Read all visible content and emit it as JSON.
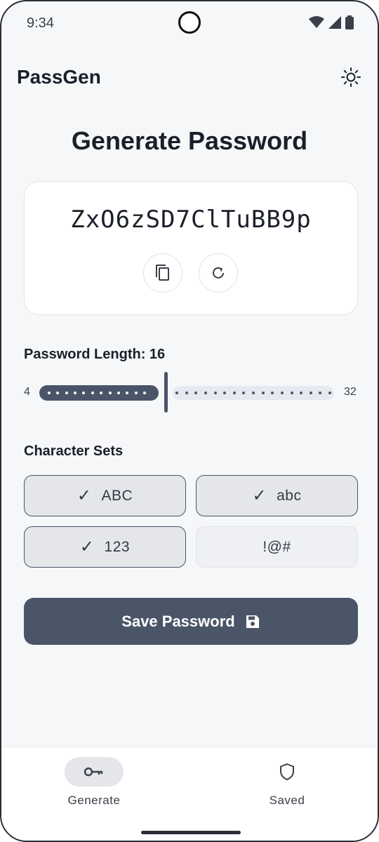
{
  "status_bar": {
    "time": "9:34"
  },
  "app_bar": {
    "title": "PassGen",
    "theme_icon": "sun-icon"
  },
  "page": {
    "title": "Generate Password"
  },
  "password": {
    "value": "ZxO6zSD7ClTuBB9p",
    "copy_icon": "copy-icon",
    "refresh_icon": "refresh-icon"
  },
  "length": {
    "label": "Password Length: 16",
    "value": 16,
    "min_label": "4",
    "max_label": "32",
    "min": 4,
    "max": 32
  },
  "character_sets": {
    "label": "Character Sets",
    "items": [
      {
        "label": "ABC",
        "checked": true
      },
      {
        "label": "abc",
        "checked": true
      },
      {
        "label": "123",
        "checked": true
      },
      {
        "label": "!@#",
        "checked": false
      }
    ],
    "check_mark": "✓"
  },
  "save_button": {
    "label": "Save Password",
    "icon": "save-icon"
  },
  "bottom_nav": {
    "items": [
      {
        "label": "Generate",
        "icon": "key-icon",
        "active": true
      },
      {
        "label": "Saved",
        "icon": "shield-icon",
        "active": false
      }
    ]
  },
  "colors": {
    "primary": "#4a5568",
    "background": "#f6f7f9",
    "surface": "#ffffff"
  }
}
